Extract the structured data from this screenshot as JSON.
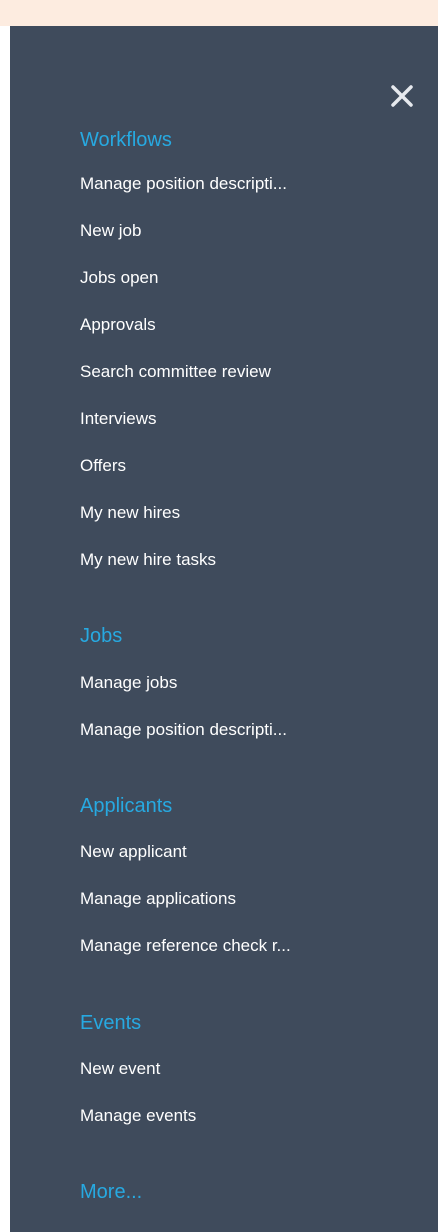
{
  "menu": {
    "sections": [
      {
        "title": "Workflows",
        "items": [
          "Manage position descripti...",
          "New job",
          "Jobs open",
          "Approvals",
          "Search committee review",
          "Interviews",
          "Offers",
          "My new hires",
          "My new hire tasks"
        ]
      },
      {
        "title": "Jobs",
        "items": [
          "Manage jobs",
          "Manage position descripti..."
        ]
      },
      {
        "title": "Applicants",
        "items": [
          "New applicant",
          "Manage applications",
          "Manage reference check r..."
        ]
      },
      {
        "title": "Events",
        "items": [
          "New event",
          "Manage events"
        ]
      }
    ],
    "more_label": "More..."
  },
  "colors": {
    "panel_bg": "#3f4b5c",
    "top_strip": "#fdece0",
    "section_title": "#27a9e1",
    "item_text": "#ffffff"
  },
  "icons": {
    "close": "close-icon"
  }
}
